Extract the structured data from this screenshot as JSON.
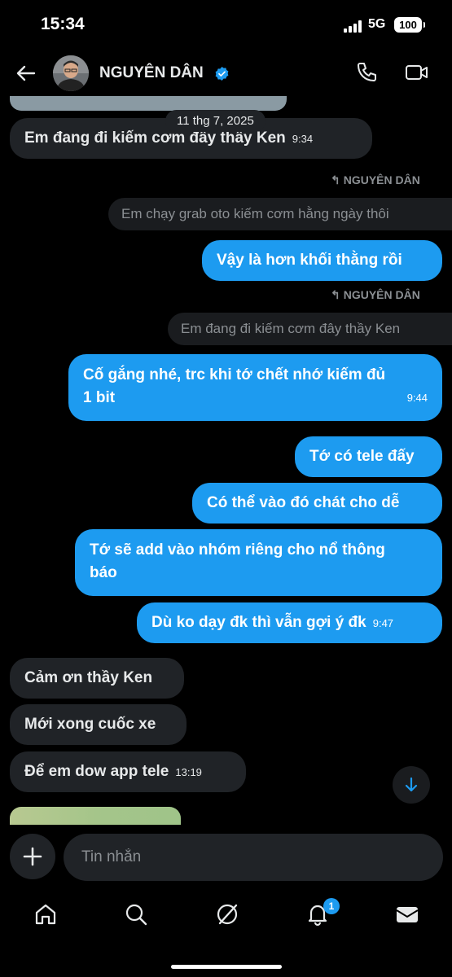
{
  "status_bar": {
    "time": "15:34",
    "network": "5G",
    "battery": "100"
  },
  "header": {
    "contact_name": "NGUYÊN DÂN"
  },
  "date_separator": "11 thg 7, 2025",
  "messages": [
    {
      "text": "Em đang đi kiếm cơm đây thầy Ken",
      "time": "9:34"
    },
    {
      "reply_label": "NGUYÊN DÂN",
      "quote": "Em chạy grab oto kiếm cơm hằng ngày thôi"
    },
    {
      "text": "Vậy là hơn khối thằng rồi"
    },
    {
      "reply_label": "NGUYÊN DÂN",
      "quote": "Em đang đi kiếm cơm đây thầy Ken"
    },
    {
      "text_line1": "Cố gắng nhé, trc khi tớ chết nhớ kiếm đủ",
      "text_line2": "1 bit",
      "time": "9:44"
    },
    {
      "text": "Tớ có tele đấy"
    },
    {
      "text": "Có thể vào đó chát cho dễ"
    },
    {
      "text_line1": "Tớ sẽ add vào nhóm riêng cho nổ thông",
      "text_line2": "báo"
    },
    {
      "text": "Dù ko dạy đk thì vẫn gợi ý đk",
      "time": "9:47"
    },
    {
      "text": "Cảm ơn thầy Ken"
    },
    {
      "text": "Mới xong cuốc xe"
    },
    {
      "text": "Để em dow app tele",
      "time": "13:19"
    }
  ],
  "composer": {
    "placeholder": "Tin nhắn"
  },
  "nav": {
    "notifications_badge": "1"
  },
  "colors": {
    "accent": "#1d9bf0",
    "received_bubble": "#202327",
    "background": "#000000"
  }
}
